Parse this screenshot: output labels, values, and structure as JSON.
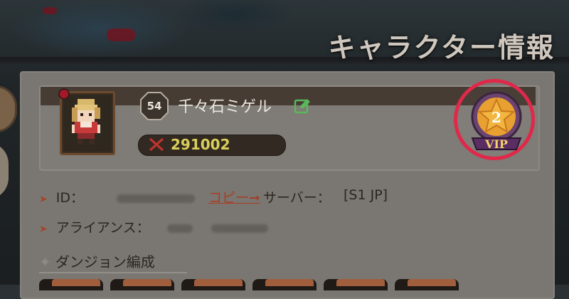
{
  "header": {
    "title": "キャラクター情報"
  },
  "profile": {
    "level": "54",
    "name": "千々石ミゲル",
    "power": "291002",
    "vip_level": "2",
    "vip_label": "VIP"
  },
  "info": {
    "id_label": "ID：",
    "copy_label": "コピー",
    "server_label": "サーバー：",
    "server_value": "[S1 JP]",
    "alliance_label": "アライアンス："
  },
  "section": {
    "dungeon_label": "ダンジョン編成"
  },
  "icons": {
    "edit": "edit-icon",
    "power": "crossed-swords-icon",
    "vip": "star-medal-icon",
    "bullet": "arrow-bullet-icon"
  },
  "colors": {
    "highlight_ring": "#e0284a",
    "power_text": "#d9cf5a",
    "link": "#a63f25",
    "edit_icon": "#59b85a"
  }
}
